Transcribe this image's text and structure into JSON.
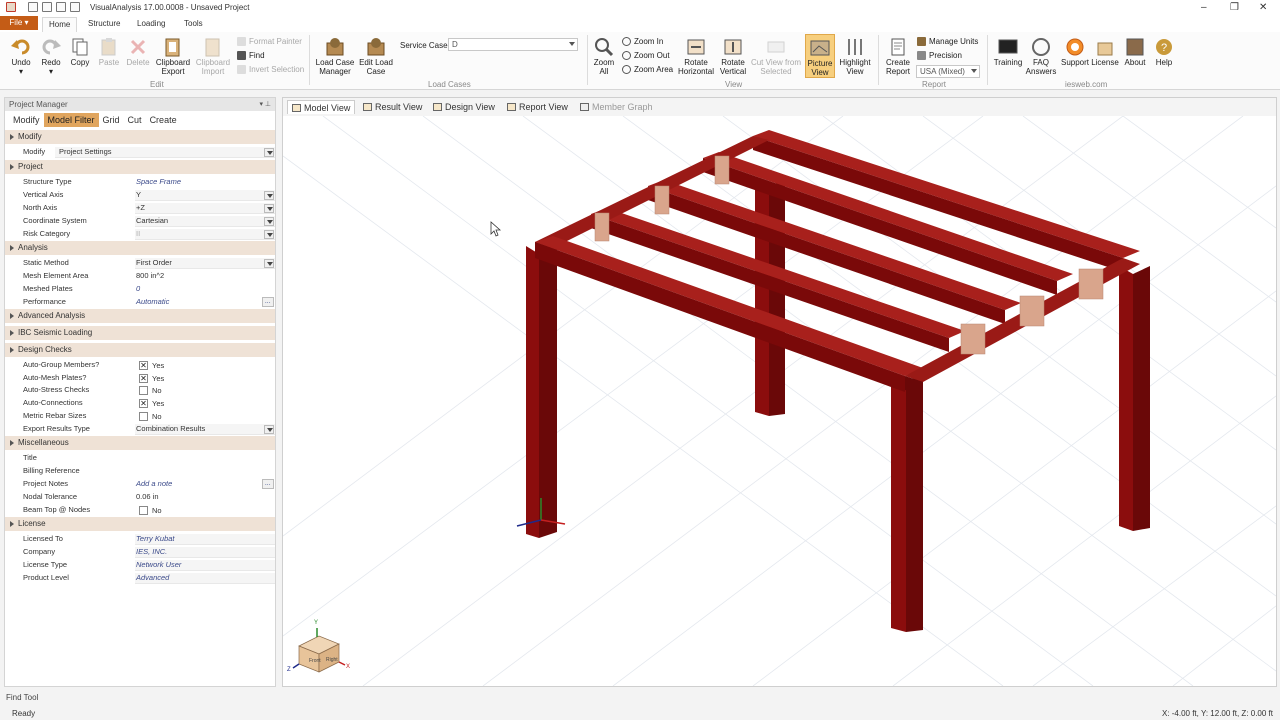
{
  "app": {
    "title": "VisualAnalysis 17.00.0008 - Unsaved Project"
  },
  "menu": {
    "file": "File ▾",
    "tabs": [
      "Home",
      "Structure",
      "Loading",
      "Tools"
    ]
  },
  "ribbon": {
    "edit": {
      "undo": "Undo",
      "redo": "Redo",
      "copy": "Copy",
      "paste": "Paste",
      "delete": "Delete",
      "clipboard_export": "Clipboard\nExport",
      "clipboard_import": "Clipboard\nImport",
      "format_painter": "Format Painter",
      "find": "Find",
      "invert_selection": "Invert Selection",
      "group_label": "Edit"
    },
    "loadcase": {
      "manager": "Load Case\nManager",
      "edit": "Edit Load\nCase",
      "service_case_label": "Service Case",
      "service_case_value": "D",
      "group_label": "Load Cases"
    },
    "view": {
      "zoom_all": "Zoom\nAll",
      "zoom_in": "Zoom In",
      "zoom_out": "Zoom Out",
      "zoom_area": "Zoom Area",
      "rotate_h": "Rotate\nHorizontal",
      "rotate_v": "Rotate\nVertical",
      "cut_view": "Cut View from\nSelected",
      "picture_view": "Picture\nView",
      "highlight_view": "Highlight\nView",
      "group_label": "View"
    },
    "report": {
      "create": "Create\nReport",
      "manage_units": "Manage Units",
      "precision": "Precision",
      "units_value": "USA (Mixed)",
      "group_label": "Report"
    },
    "iesweb": {
      "training": "Training",
      "faq": "FAQ\nAnswers",
      "support": "Support",
      "license": "License",
      "about": "About",
      "help": "Help",
      "group_label": "iesweb.com"
    }
  },
  "project_manager": {
    "title": "Project Manager",
    "pin": "▾ ⊥",
    "tabs": [
      "Modify",
      "Model Filter",
      "Grid",
      "Cut",
      "Create"
    ],
    "sections": {
      "modify": "Modify",
      "project": "Project",
      "analysis": "Analysis",
      "advanced": "Advanced Analysis",
      "ibc": "IBC Seismic Loading",
      "design": "Design Checks",
      "misc": "Miscellaneous",
      "license": "License"
    },
    "rows": {
      "modify_lbl": "Modify",
      "modify_val": "Project Settings",
      "structure_type_lbl": "Structure Type",
      "structure_type_val": "Space Frame",
      "vertical_axis_lbl": "Vertical Axis",
      "vertical_axis_val": "Y",
      "north_axis_lbl": "North Axis",
      "north_axis_val": "+Z",
      "coord_lbl": "Coordinate System",
      "coord_val": "Cartesian",
      "risk_lbl": "Risk Category",
      "risk_val": "II",
      "static_lbl": "Static Method",
      "static_val": "First Order",
      "mesh_area_lbl": "Mesh Element Area",
      "mesh_area_val": "800 in^2",
      "meshed_plates_lbl": "Meshed Plates",
      "meshed_plates_val": "0",
      "performance_lbl": "Performance",
      "performance_val": "Automatic",
      "auto_group_lbl": "Auto-Group Members?",
      "auto_group_val": "Yes",
      "auto_mesh_lbl": "Auto-Mesh Plates?",
      "auto_mesh_val": "Yes",
      "auto_stress_lbl": "Auto-Stress Checks",
      "auto_stress_val": "No",
      "auto_conn_lbl": "Auto-Connections",
      "auto_conn_val": "Yes",
      "metric_lbl": "Metric Rebar Sizes",
      "metric_val": "No",
      "export_lbl": "Export Results Type",
      "export_val": "Combination Results",
      "title_lbl": "Title",
      "billing_lbl": "Billing Reference",
      "notes_lbl": "Project Notes",
      "notes_val": "Add a note",
      "nodal_lbl": "Nodal Tolerance",
      "nodal_val": "0.06 in",
      "beamtop_lbl": "Beam Top @ Nodes",
      "beamtop_val": "No",
      "licensed_lbl": "Licensed To",
      "licensed_val": "Terry Kubat",
      "company_lbl": "Company",
      "company_val": "IES, INC.",
      "lictype_lbl": "License Type",
      "lictype_val": "Network User",
      "product_lbl": "Product Level",
      "product_val": "Advanced"
    }
  },
  "view_tabs": [
    "Model View",
    "Result View",
    "Design View",
    "Report View",
    "Member Graph"
  ],
  "viewcube": {
    "front": "Front",
    "right": "Right",
    "axis_x": "X",
    "axis_y": "Y",
    "axis_z": "Z"
  },
  "status": {
    "find_tool": "Find Tool",
    "ready": "Ready",
    "coords": "X: -4.00 ft, Y: 12.00 ft, Z: 0.00 ft"
  },
  "colors": {
    "member": "#8b0d0d",
    "member_dark": "#5e0707",
    "member_light": "#a8201c",
    "connection": "#d9a58c",
    "accent": "#c45c16"
  }
}
